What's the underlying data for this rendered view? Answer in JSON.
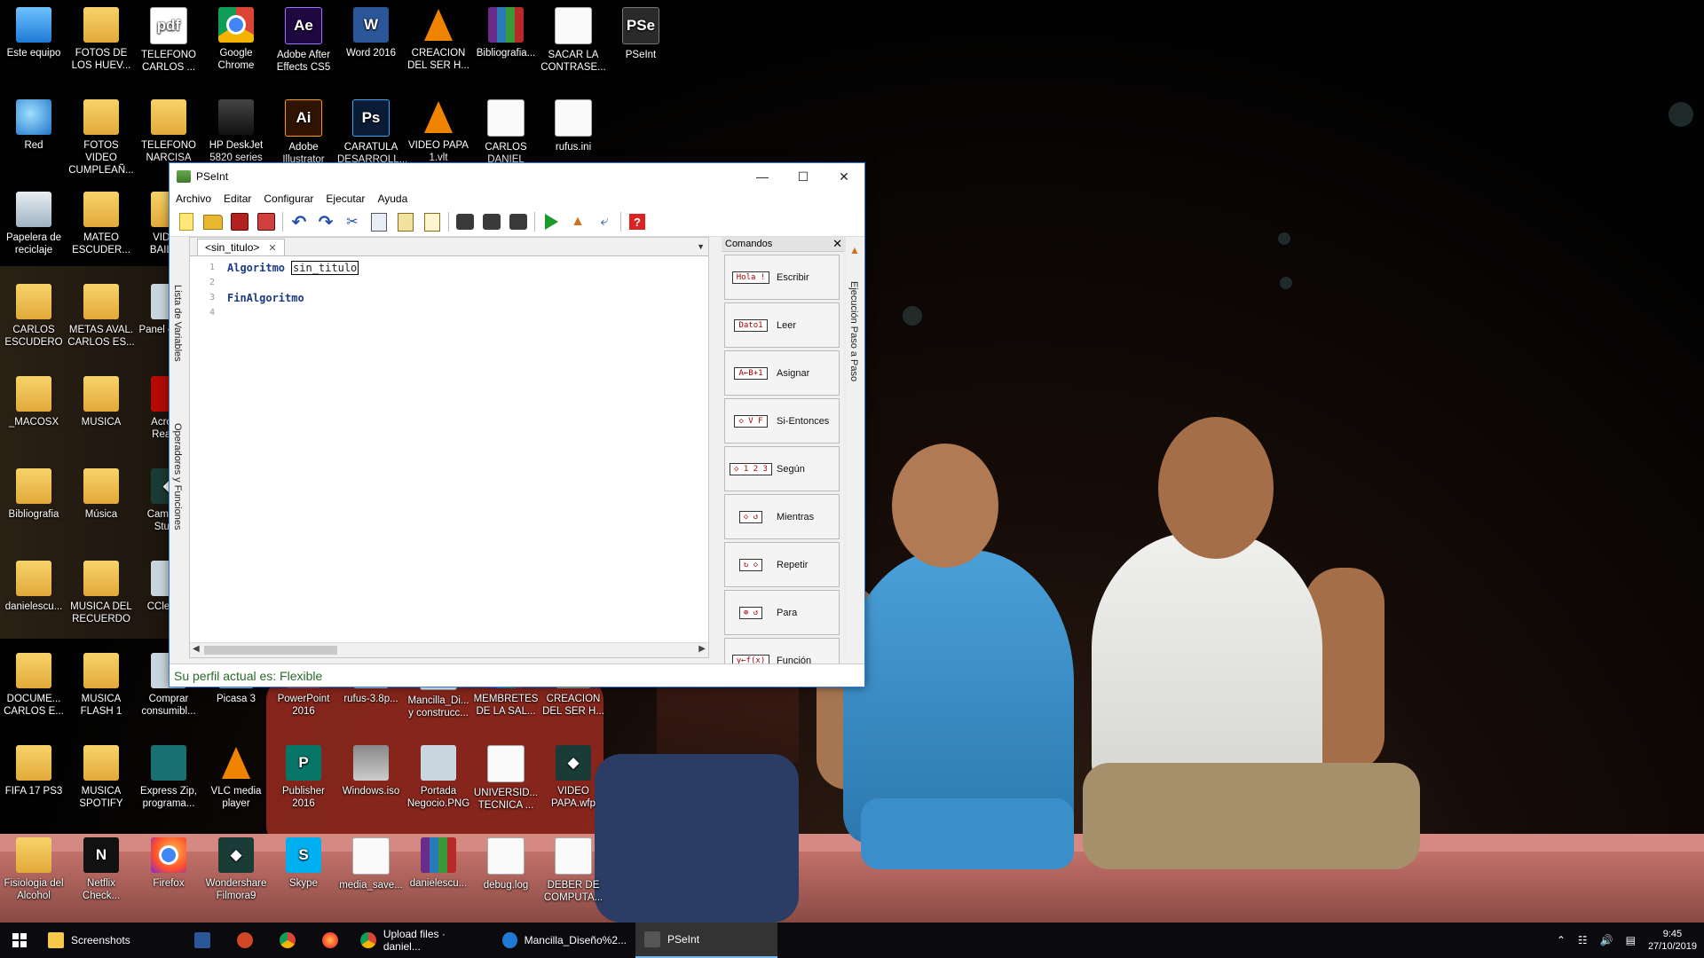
{
  "desktop": {
    "icons": [
      {
        "label": "Este equipo",
        "icon": "computer-icon"
      },
      {
        "label": "FOTOS DE LOS HUEV...",
        "icon": "folder-icon"
      },
      {
        "label": "TELEFONO CARLOS ...",
        "icon": "pdf-icon"
      },
      {
        "label": "Google Chrome",
        "icon": "chrome-icon"
      },
      {
        "label": "Adobe After Effects CS5",
        "icon": "after-effects-icon"
      },
      {
        "label": "Word 2016",
        "icon": "word-icon"
      },
      {
        "label": "CREACION DEL SER H...",
        "icon": "vlc-icon"
      },
      {
        "label": "Bibliografia...",
        "icon": "winrar-icon"
      },
      {
        "label": "SACAR LA CONTRASE...",
        "icon": "text-file-icon"
      },
      {
        "label": "PSeInt",
        "icon": "pseint-icon"
      },
      {
        "label": "Red",
        "icon": "network-icon"
      },
      {
        "label": "FOTOS VIDEO CUMPLEAÑ...",
        "icon": "folder-icon"
      },
      {
        "label": "TELEFONO NARCISA",
        "icon": "folder-icon"
      },
      {
        "label": "HP DeskJet 5820 series",
        "icon": "printer-icon"
      },
      {
        "label": "Adobe Illustrator",
        "icon": "illustrator-icon"
      },
      {
        "label": "CARATULA DESARROLL...",
        "icon": "photoshop-icon"
      },
      {
        "label": "VIDEO PAPA 1.vlt",
        "icon": "vlc-icon"
      },
      {
        "label": "CARLOS DANIEL ESC...",
        "icon": "word-doc-icon"
      },
      {
        "label": "rufus.ini",
        "icon": "ini-file-icon"
      },
      {
        "label": "Papelera de reciclaje",
        "icon": "recycle-bin-icon"
      },
      {
        "label": "MATEO ESCUDER...",
        "icon": "folder-icon"
      },
      {
        "label": "VIDEO BAILA...",
        "icon": "video-icon"
      },
      {
        "label": "CARLOS ESCUDERO",
        "icon": "user-folder-icon"
      },
      {
        "label": "METAS AVAL. CARLOS ES...",
        "icon": "folder-icon"
      },
      {
        "label": "Panel control",
        "icon": "control-panel-icon"
      },
      {
        "label": "_MACOSX",
        "icon": "folder-icon"
      },
      {
        "label": "MUSICA",
        "icon": "folder-icon"
      },
      {
        "label": "Acrobat Reader",
        "icon": "acrobat-icon"
      },
      {
        "label": "Bibliografia",
        "icon": "folder-icon"
      },
      {
        "label": "Música",
        "icon": "music-folder-icon"
      },
      {
        "label": "Camtasia Studio",
        "icon": "camtasia-icon"
      },
      {
        "label": "danielescu...",
        "icon": "folder-icon"
      },
      {
        "label": "MUSICA DEL RECUERDO",
        "icon": "music-folder-icon"
      },
      {
        "label": "CCleaner",
        "icon": "ccleaner-icon"
      },
      {
        "label": "DOCUME... CARLOS E...",
        "icon": "folder-icon"
      },
      {
        "label": "MUSICA FLASH 1",
        "icon": "music-folder-icon"
      },
      {
        "label": "Comprar consumibl...",
        "icon": "printer-shop-icon"
      },
      {
        "label": "Picasa 3",
        "icon": "picasa-icon"
      },
      {
        "label": "PowerPoint 2016",
        "icon": "powerpoint-icon"
      },
      {
        "label": "rufus-3.8p...",
        "icon": "usb-icon"
      },
      {
        "label": "Mancilla_Di... y construcc...",
        "icon": "pdf-icon"
      },
      {
        "label": "MEMBRETES DE LA SAL...",
        "icon": "winrar-icon"
      },
      {
        "label": "CREACION DEL SER H...",
        "icon": "folder-icon"
      },
      {
        "label": "FIFA 17 PS3",
        "icon": "folder-icon"
      },
      {
        "label": "MUSICA SPOTIFY",
        "icon": "music-folder-icon"
      },
      {
        "label": "Express Zip, programa...",
        "icon": "zip-icon"
      },
      {
        "label": "VLC media player",
        "icon": "vlc-icon"
      },
      {
        "label": "Publisher 2016",
        "icon": "publisher-icon"
      },
      {
        "label": "Windows.iso",
        "icon": "iso-icon"
      },
      {
        "label": "Portada Negocio.PNG",
        "icon": "image-icon"
      },
      {
        "label": "UNIVERSID... TECNICA ...",
        "icon": "word-doc-icon"
      },
      {
        "label": "VIDEO PAPA.wfp",
        "icon": "filmora-file-icon"
      },
      {
        "label": "Fisiologia del Alcohol",
        "icon": "folder-icon"
      },
      {
        "label": "Netflix Check...",
        "icon": "netflix-icon"
      },
      {
        "label": "Firefox",
        "icon": "firefox-icon"
      },
      {
        "label": "Wondershare Filmora9",
        "icon": "filmora-icon"
      },
      {
        "label": "Skype",
        "icon": "skype-icon"
      },
      {
        "label": "media_save...",
        "icon": "text-file-icon"
      },
      {
        "label": "danielescu...",
        "icon": "winrar-icon"
      },
      {
        "label": "debug.log",
        "icon": "text-file-icon"
      },
      {
        "label": "DEBER DE COMPUTA...",
        "icon": "word-doc-icon"
      }
    ]
  },
  "pseint": {
    "title": "PSeInt",
    "menu": [
      "Archivo",
      "Editar",
      "Configurar",
      "Ejecutar",
      "Ayuda"
    ],
    "tab": "<sin_titulo>",
    "code": {
      "line_numbers": [
        "1",
        "2",
        "3",
        "4"
      ],
      "keyword_start": "Algoritmo",
      "algorithm_name": "sin_titulo",
      "keyword_end": "FinAlgoritmo"
    },
    "left_panels": [
      "Lista de Variables",
      "Operadores y Funciones"
    ],
    "right_panel": "Ejecución Paso a Paso",
    "commands_title": "Comandos",
    "commands": [
      {
        "label": "Escribir",
        "glyph": "Hola !"
      },
      {
        "label": "Leer",
        "glyph": "Dato1"
      },
      {
        "label": "Asignar",
        "glyph": "A←B+1"
      },
      {
        "label": "Si-Entonces",
        "glyph": "◇ V F"
      },
      {
        "label": "Según",
        "glyph": "◇ 1 2 3"
      },
      {
        "label": "Mientras",
        "glyph": "◇ ↺"
      },
      {
        "label": "Repetir",
        "glyph": "↻ ◇"
      },
      {
        "label": "Para",
        "glyph": "⊕ ↺"
      },
      {
        "label": "Función",
        "glyph": "y←f(x)"
      }
    ],
    "status": "Su perfil actual es: Flexible"
  },
  "taskbar": {
    "items": [
      {
        "label": "Screenshots",
        "icon": "folder-icon"
      },
      {
        "label": "",
        "icon": "word-icon"
      },
      {
        "label": "",
        "icon": "powerpoint-icon"
      },
      {
        "label": "",
        "icon": "chrome-icon"
      },
      {
        "label": "",
        "icon": "firefox-icon"
      },
      {
        "label": "Upload files · daniel...",
        "icon": "chrome-icon"
      },
      {
        "label": "Mancilla_Diseño%2...",
        "icon": "edge-icon"
      },
      {
        "label": "PSeInt",
        "icon": "pseint-icon"
      }
    ],
    "time": "9:45",
    "date": "27/10/2019"
  },
  "colors": {
    "accent": "#2f7fd6",
    "status_text": "#2a6a2a",
    "keyword": "#1a3a8a"
  }
}
